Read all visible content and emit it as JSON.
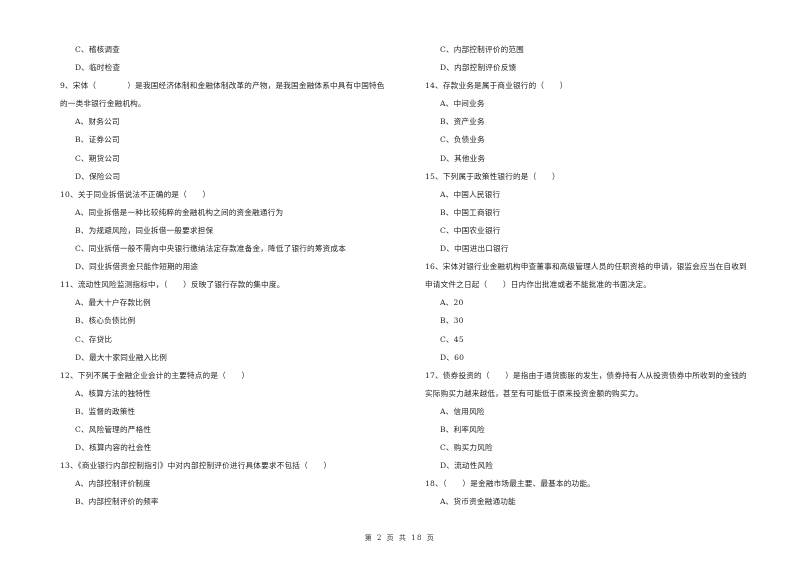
{
  "left_column": [
    {
      "type": "option",
      "text": "C、稽核调查"
    },
    {
      "type": "option",
      "text": "D、临时检查"
    },
    {
      "type": "question",
      "text": "9、宋体（　　　　）是我国经济体制和金融体制改革的产物，是我国金融体系中具有中国特色"
    },
    {
      "type": "cont",
      "text": "的一类非银行金融机构。"
    },
    {
      "type": "option",
      "text": "A、财务公司"
    },
    {
      "type": "option",
      "text": "B、证券公司"
    },
    {
      "type": "option",
      "text": "C、期货公司"
    },
    {
      "type": "option",
      "text": "D、保险公司"
    },
    {
      "type": "question",
      "text": "10、关于同业拆借说法不正确的是（　　）"
    },
    {
      "type": "option",
      "text": "A、同业拆借是一种比较纯粹的金融机构之间的资金融通行为"
    },
    {
      "type": "option",
      "text": "B、为规避风险，同业拆借一般要求担保"
    },
    {
      "type": "option",
      "text": "C、同业拆借一般不需向中央银行缴纳法定存款准备金，降低了银行的筹资成本"
    },
    {
      "type": "option",
      "text": "D、同业拆借资金只能作短期的用途"
    },
    {
      "type": "question",
      "text": "11、流动性风险监测指标中，（　　）反映了银行存款的集中度。"
    },
    {
      "type": "option",
      "text": "A、最大十户存款比例"
    },
    {
      "type": "option",
      "text": "B、核心负债比例"
    },
    {
      "type": "option",
      "text": "C、存贷比"
    },
    {
      "type": "option",
      "text": "D、最大十家同业融入比例"
    },
    {
      "type": "question",
      "text": "12、下列不属于金融企业会计的主要特点的是（　　）"
    },
    {
      "type": "option",
      "text": "A、核算方法的独特性"
    },
    {
      "type": "option",
      "text": "B、监督的政策性"
    },
    {
      "type": "option",
      "text": "C、风险管理的严格性"
    },
    {
      "type": "option",
      "text": "D、核算内容的社会性"
    },
    {
      "type": "question",
      "text": "13、《商业银行内部控制指引》中对内部控制评价进行具体要求不包括（　　）"
    },
    {
      "type": "option",
      "text": "A、内部控制评价制度"
    },
    {
      "type": "option",
      "text": "B、内部控制评价的频率"
    }
  ],
  "right_column": [
    {
      "type": "option",
      "text": "C、内部控制评价的范围"
    },
    {
      "type": "option",
      "text": "D、内部控制评价反馈"
    },
    {
      "type": "question",
      "text": "14、存款业务是属于商业银行的（　　）"
    },
    {
      "type": "option",
      "text": "A、中间业务"
    },
    {
      "type": "option",
      "text": "B、资产业务"
    },
    {
      "type": "option",
      "text": "C、负债业务"
    },
    {
      "type": "option",
      "text": "D、其他业务"
    },
    {
      "type": "question",
      "text": "15、下列属于政策性银行的是（　　）"
    },
    {
      "type": "option",
      "text": "A、中国人民银行"
    },
    {
      "type": "option",
      "text": "B、中国工商银行"
    },
    {
      "type": "option",
      "text": "C、中国农业银行"
    },
    {
      "type": "option",
      "text": "D、中国进出口银行"
    },
    {
      "type": "question",
      "text": "16、宋体对银行业金融机构申查董事和高级管理人员的任职资格的申请，银监会应当在自收到"
    },
    {
      "type": "cont",
      "text": "申请文件之日起（　　）日内作出批准或者不能批准的书面决定。"
    },
    {
      "type": "option",
      "text": "A、20"
    },
    {
      "type": "option",
      "text": "B、30"
    },
    {
      "type": "option",
      "text": "C、45"
    },
    {
      "type": "option",
      "text": "D、60"
    },
    {
      "type": "question",
      "text": "17、债券投资的（　　）是指由于通货膨胀的发生，债券持有人从投资债券中所收到的金钱的"
    },
    {
      "type": "cont",
      "text": "实际购买力越来越低，甚至有可能低于原来投资金额的购买力。"
    },
    {
      "type": "option",
      "text": "A、信用风险"
    },
    {
      "type": "option",
      "text": "B、利率风险"
    },
    {
      "type": "option",
      "text": "C、购买力风险"
    },
    {
      "type": "option",
      "text": "D、流动性风险"
    },
    {
      "type": "question",
      "text": "18、（　　）是金融市场最主要、最基本的功能。"
    },
    {
      "type": "option",
      "text": "A、货币资金融通功能"
    }
  ],
  "footer": {
    "page_label": "第 2 页 共 18 页"
  }
}
